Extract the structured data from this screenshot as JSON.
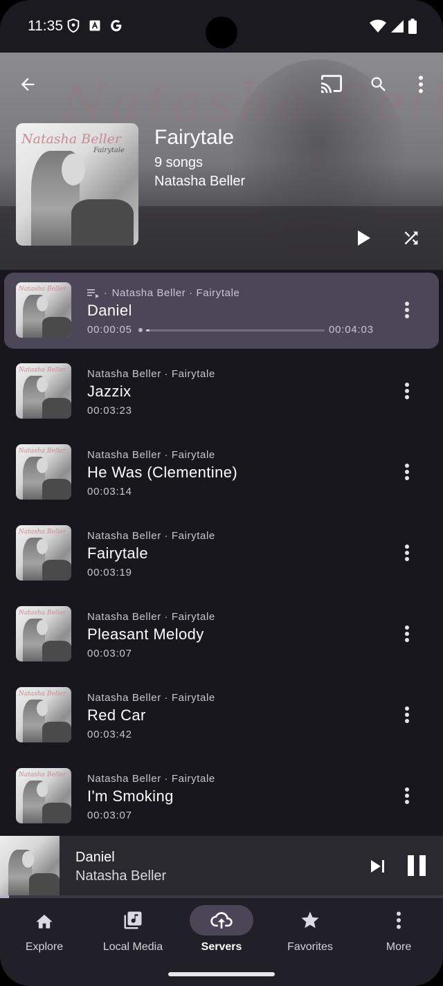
{
  "status_bar": {
    "time": "11:35"
  },
  "header": {
    "album_title": "Fairytale",
    "song_count": "9 songs",
    "artist": "Natasha Beller",
    "cover_text": "Natasha Beller",
    "cover_subtext": "Fairytale"
  },
  "songs": [
    {
      "meta": "Natasha Beller · Fairytale",
      "title": "Daniel",
      "elapsed": "00:00:05",
      "duration": "00:04:03",
      "progress": 0.02,
      "playing": true
    },
    {
      "meta": "Natasha Beller · Fairytale",
      "title": "Jazzix",
      "duration": "00:03:23"
    },
    {
      "meta": "Natasha Beller · Fairytale",
      "title": "He Was (Clementine)",
      "duration": "00:03:14"
    },
    {
      "meta": "Natasha Beller · Fairytale",
      "title": "Fairytale",
      "duration": "00:03:19"
    },
    {
      "meta": "Natasha Beller · Fairytale",
      "title": "Pleasant Melody",
      "duration": "00:03:07"
    },
    {
      "meta": "Natasha Beller · Fairytale",
      "title": "Red Car",
      "duration": "00:03:42"
    },
    {
      "meta": "Natasha Beller · Fairytale",
      "title": "I'm Smoking",
      "duration": "00:03:07"
    }
  ],
  "mini_player": {
    "title": "Daniel",
    "artist": "Natasha Beller",
    "progress": 0.02
  },
  "nav": [
    {
      "label": "Explore",
      "icon": "home-icon"
    },
    {
      "label": "Local Media",
      "icon": "library-music-icon"
    },
    {
      "label": "Servers",
      "icon": "cloud-sync-icon",
      "active": true
    },
    {
      "label": "Favorites",
      "icon": "star-icon"
    },
    {
      "label": "More",
      "icon": "more-vertical-icon"
    }
  ],
  "colors": {
    "accent_surface": "#4c4758",
    "background": "#18171d",
    "nav_active_pill": "#4a4658"
  }
}
